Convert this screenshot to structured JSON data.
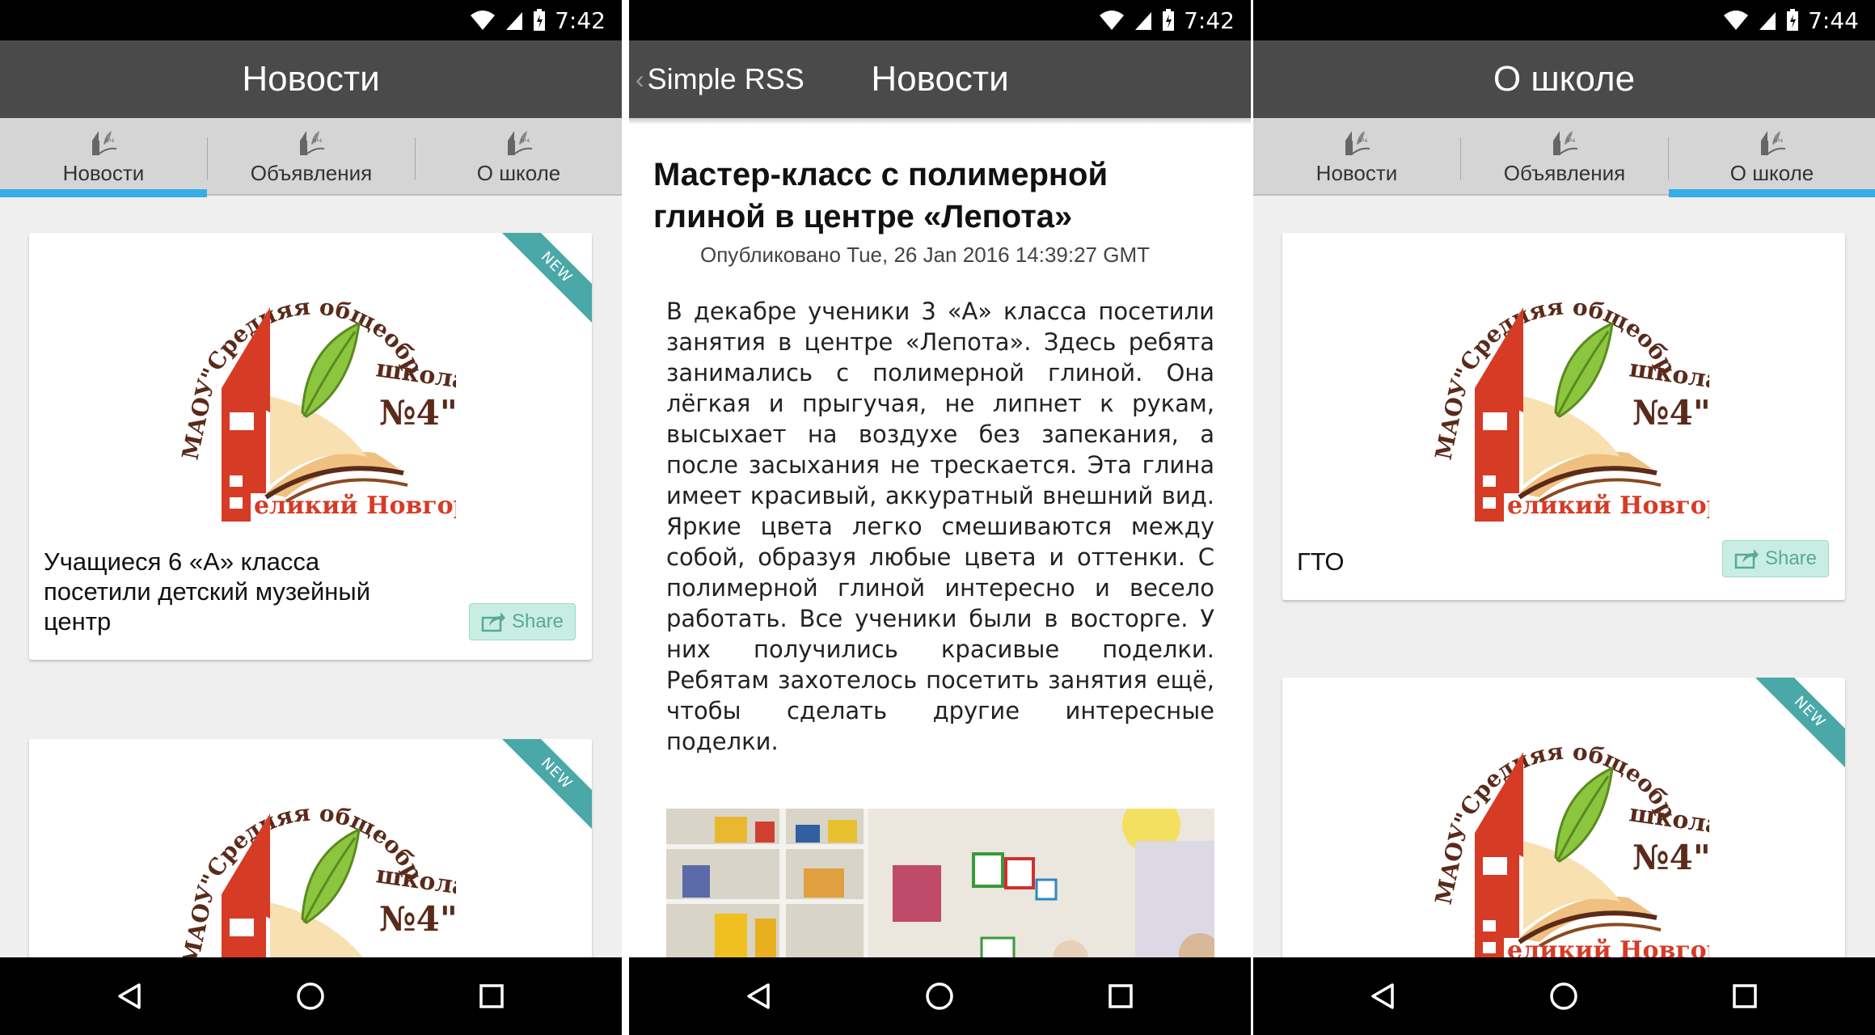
{
  "colors": {
    "status_bar": "#000000",
    "app_bar": "#4a4a4a",
    "tab_bar": "#d5d5d5",
    "tab_accent": "#35aee8",
    "share_bg": "#c8eee3",
    "ribbon": "#4aa8a8",
    "logo_red": "#d63b26",
    "logo_green": "#8cc63f",
    "logo_brown": "#5a2a1a"
  },
  "panel1": {
    "status": {
      "time": "7:42"
    },
    "app_bar": {
      "title": "Новости"
    },
    "tabs": [
      {
        "label": "Новости",
        "selected": true,
        "icon": "school-logo-icon"
      },
      {
        "label": "Объявления",
        "selected": false,
        "icon": "school-logo-icon"
      },
      {
        "label": "О школе",
        "selected": false,
        "icon": "school-logo-icon"
      }
    ],
    "cards": [
      {
        "title": "Учащиеся 6 «А» класса посетили детский музейный центр",
        "badge": "NEW",
        "share_label": "Share"
      },
      {
        "title": "",
        "badge": "NEW"
      }
    ]
  },
  "panel2": {
    "status": {
      "time": "7:42"
    },
    "app_bar": {
      "back_label": "Simple RSS",
      "title": "Новости"
    },
    "article": {
      "title": "Мастер-класс с полимерной глиной в центре «Лепота»",
      "published": "Опубликовано Tue, 26 Jan 2016 14:39:27 GMT",
      "body": "В декабре ученики 3 «А» класса посетили занятия в центре «Лепота». Здесь ребята занимались с полимерной глиной. Она лёгкая и прыгучая, не липнет к рукам, высыхает на воздухе без запекания, а после засыхания не трескается. Эта глина имеет красивый, аккуратный внешний вид. Яркие цвета легко смешиваются между собой, образуя любые цвета и оттенки. С полимерной глиной интересно и весело работать. Все ученики были в восторге. У них получились красивые поделки. Ребятам захотелось посетить занятия ещё, чтобы сделать другие интересные поделки."
    }
  },
  "panel3": {
    "status": {
      "time": "7:44"
    },
    "app_bar": {
      "title": "О школе"
    },
    "tabs": [
      {
        "label": "Новости",
        "selected": false,
        "icon": "school-logo-icon"
      },
      {
        "label": "Объявления",
        "selected": false,
        "icon": "school-logo-icon"
      },
      {
        "label": "О школе",
        "selected": true,
        "icon": "school-logo-icon"
      }
    ],
    "cards": [
      {
        "title": "ГТО",
        "share_label": "Share"
      },
      {
        "title": "",
        "badge": "NEW"
      }
    ]
  },
  "logo": {
    "arc_text": "Средняя общеобразовательная",
    "left_text": "МАОУ",
    "school_text": "школа",
    "number_text": "№4",
    "city_text": "Великий Новгород"
  }
}
